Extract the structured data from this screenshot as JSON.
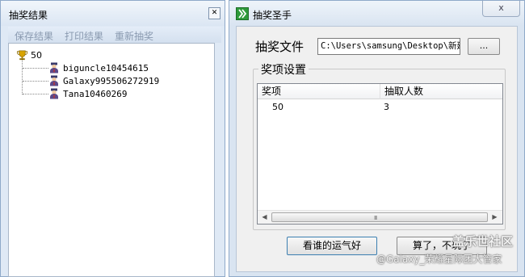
{
  "result_window": {
    "title": "抽奖结果",
    "close_icon": "close-icon",
    "toolbar": {
      "save_label": "保存结果",
      "print_label": "打印结果",
      "redraw_label": "重新抽奖"
    },
    "tree": {
      "root_label": "50",
      "root_icon": "trophy-icon",
      "winner_icon": "person-icon",
      "winners": [
        "biguncle10454615",
        "Galaxy995506272919",
        "Tana10460269"
      ]
    }
  },
  "main_window": {
    "title": "抽奖圣手",
    "app_icon": "lottery-app-icon",
    "close_label": "x",
    "file_label": "抽奖文件",
    "file_path": "C:\\Users\\samsung\\Desktop\\新建",
    "browse_label": "...",
    "prize_group_label": "奖项设置",
    "prize_list": {
      "columns": [
        "奖项",
        "抽取人数"
      ],
      "rows": [
        {
          "prize": "50",
          "count": "3"
        }
      ]
    },
    "scrollbar_grip": "III",
    "lucky_button_label": "看谁的运气好",
    "quit_button_label": "算了，不玩了"
  },
  "watermark": {
    "line1": "盖乐世社区",
    "line2": "@Galaxy_荣耀星际团大管家"
  },
  "colors": {
    "window_frame": "#dfe9f5",
    "titlebar": "#dbe6f3",
    "button_focus_border": "#3c7fb1",
    "trophy": "#d9a400"
  }
}
